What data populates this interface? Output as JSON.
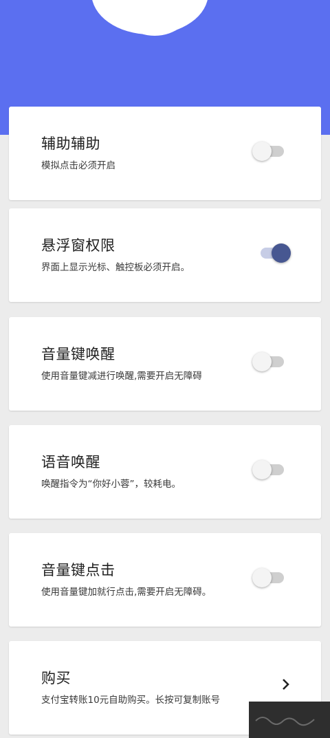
{
  "header": {
    "color": "#5b6ff0"
  },
  "settings": [
    {
      "title": "辅助辅助",
      "desc": "模拟点击必须开启",
      "control": "toggle",
      "on": false
    },
    {
      "title": "悬浮窗权限",
      "desc": "界面上显示光标、触控板必须开启。",
      "control": "toggle",
      "on": true
    },
    {
      "title": "音量键唤醒",
      "desc": "使用音量键减进行唤醒,需要开启无障碍",
      "control": "toggle",
      "on": false
    },
    {
      "title": "语音唤醒",
      "desc": "唤醒指令为“你好小蓉”，较耗电。",
      "control": "toggle",
      "on": false
    },
    {
      "title": "音量键点击",
      "desc": "使用音量键加就行点击,需要开启无障碍。",
      "control": "toggle",
      "on": false
    },
    {
      "title": "购买",
      "desc": "支付宝转账10元自助购买。长按可复制账号",
      "control": "chevron",
      "icon": "chevron-right-icon"
    }
  ]
}
